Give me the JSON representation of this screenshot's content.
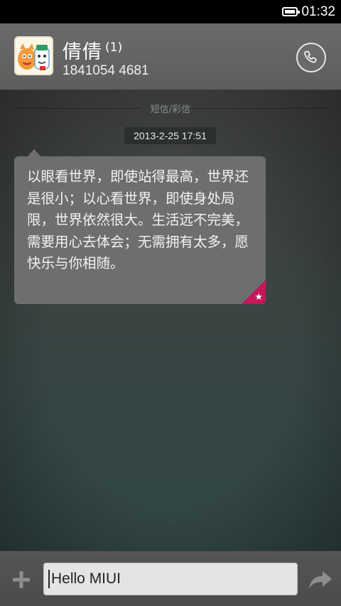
{
  "status_bar": {
    "time": "01:32",
    "battery_icon": "battery-full-icon"
  },
  "header": {
    "contact_name": "倩倩",
    "unread_count": "(1)",
    "phone_number": "1841054 4681",
    "avatar_icon": "cartoon-avatar-icon",
    "call_icon": "phone-icon"
  },
  "thread": {
    "divider_label": "短信/彩信",
    "timestamp": "2013-2-25 17:51",
    "message_text": "以眼看世界，即使站得最高，世界还是很小；以心看世界，即使身处局限，世界依然很大。生活远不完美，需要用心去体会；无需拥有太多，愿快乐与你相随。",
    "starred_icon": "star-icon",
    "accent_color": "#c3185b"
  },
  "composer": {
    "input_value": "Hello MIUI",
    "add_icon": "plus-icon",
    "send_icon": "send-arrow-icon"
  }
}
